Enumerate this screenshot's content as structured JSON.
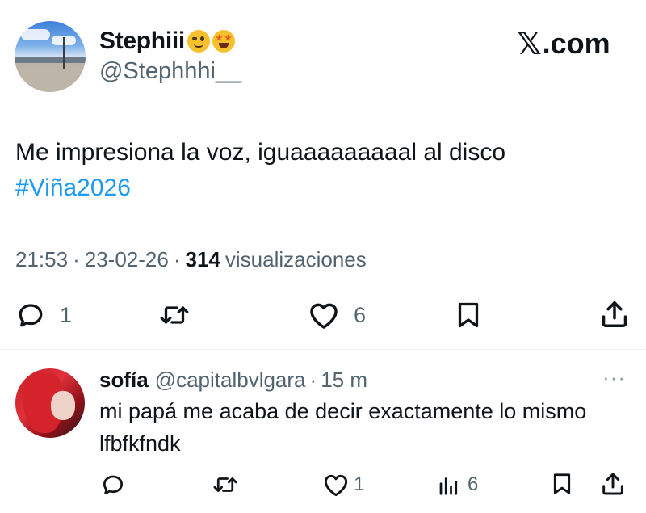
{
  "tweet": {
    "author_name": "Stephiii",
    "author_emojis": [
      "winking-face",
      "star-struck"
    ],
    "author_handle": "@Stephhhi__",
    "brand": ".com",
    "brand_mark": "𝕏",
    "text": "Me impresiona la voz, iguaaaaaaaaal al disco",
    "hashtag": "#Viña2026",
    "time": "21:53",
    "date": "23-02-26",
    "separator": "·",
    "views_count": "314",
    "views_label": "visualizaciones",
    "replies": "1",
    "likes": "6"
  },
  "reply": {
    "author_name": "sofía",
    "author_handle": "@capitalbvlgara",
    "separator": "·",
    "time": "15 m",
    "more": "···",
    "text": "mi papá me acaba de decir exactamente lo mismo lfbfkfndk",
    "likes": "1",
    "views": "6"
  },
  "colors": {
    "text": "#0f1419",
    "secondary": "#536471",
    "link": "#1d9bf0",
    "divider": "#eff3f4"
  },
  "icons": {
    "reply": "reply-icon",
    "retweet": "retweet-icon",
    "like": "like-icon",
    "bookmark": "bookmark-icon",
    "share": "share-icon",
    "views": "views-icon",
    "more": "more-icon"
  }
}
